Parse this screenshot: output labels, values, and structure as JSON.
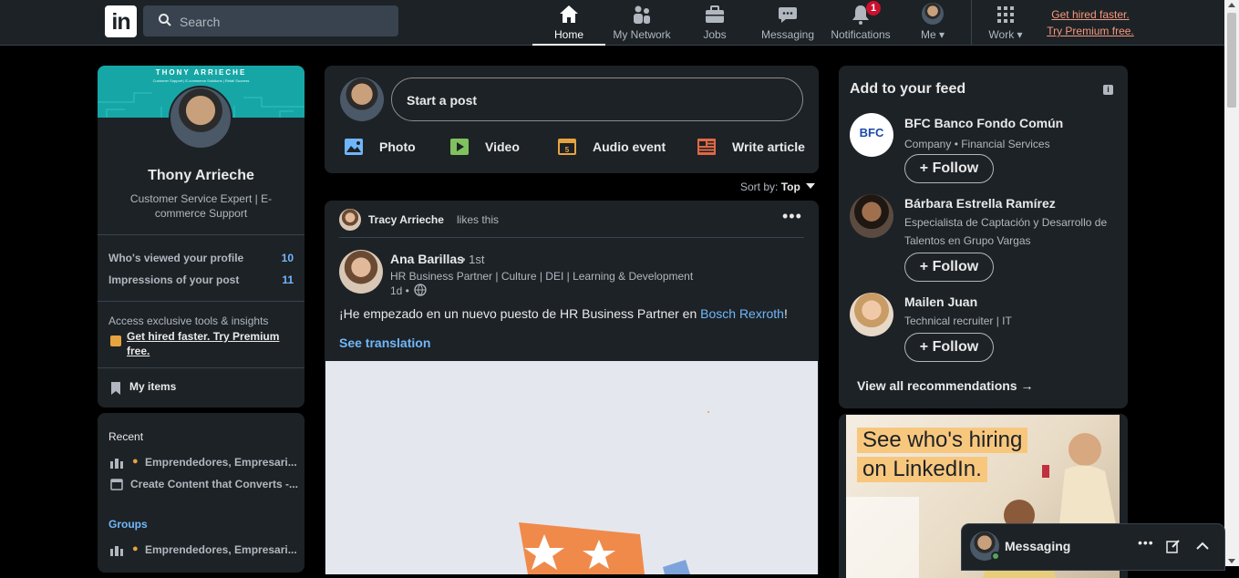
{
  "topbar": {
    "logo_text": "in",
    "search_placeholder": "Search",
    "nav": [
      {
        "label": "Home",
        "icon": "home-icon"
      },
      {
        "label": "My Network",
        "icon": "network-icon"
      },
      {
        "label": "Jobs",
        "icon": "briefcase-icon"
      },
      {
        "label": "Messaging",
        "icon": "chat-icon"
      },
      {
        "label": "Notifications",
        "icon": "bell-icon",
        "badge": "1"
      },
      {
        "label": "Me",
        "icon": "avatar"
      },
      {
        "label": "Work",
        "icon": "grid-icon"
      }
    ],
    "premium_line1": "Get hired faster.",
    "premium_line2": "Try Premium free."
  },
  "left": {
    "banner_title": "THONY ARRIECHE",
    "banner_sub": "Customer Support | E-commerce Solutions | Retail Success",
    "name": "Thony Arrieche",
    "headline": "Customer Service Expert | E-commerce Support",
    "stats": [
      {
        "label": "Who's viewed your profile",
        "value": "10"
      },
      {
        "label": "Impressions of your post",
        "value": "11"
      }
    ],
    "premium_promo": "Access exclusive tools & insights",
    "premium_link": "Get hired faster. Try Premium free.",
    "my_items": "My items",
    "recent_title": "Recent",
    "recent": [
      "Emprendedores, Empresari...",
      "Create Content that Converts -..."
    ],
    "groups_title": "Groups",
    "groups": [
      "Emprendedores, Empresari..."
    ]
  },
  "composer": {
    "placeholder": "Start a post",
    "actions": [
      "Photo",
      "Video",
      "Audio event",
      "Write article"
    ],
    "sort_label": "Sort by:",
    "sort_value": "Top"
  },
  "post": {
    "liker": "Tracy Arrieche",
    "liker_action": "likes this",
    "author": "Ana Barillas",
    "degree": "• 1st",
    "headline": "HR Business Partner | Culture | DEI | Learning & Development",
    "time": "1d •",
    "text_before": "¡He empezado en un nuevo puesto de HR Business Partner en ",
    "text_link": "Bosch Rexroth",
    "text_after": "!",
    "see_translation": "See translation"
  },
  "feed": {
    "title": "Add to your feed",
    "items": [
      {
        "name": "BFC Banco Fondo Común",
        "desc": "Company • Financial Services",
        "follow": "Follow",
        "logo_text": "BFC"
      },
      {
        "name": "Bárbara Estrella Ramírez",
        "desc": "Especialista de Captación y Desarrollo de Talentos en Grupo Vargas",
        "follow": "Follow"
      },
      {
        "name": "Mailen Juan",
        "desc": "Technical recruiter | IT",
        "follow": "Follow"
      }
    ],
    "view_all": "View all recommendations →"
  },
  "ad": {
    "line1": "See who's hiring",
    "line2": "on LinkedIn."
  },
  "messaging": {
    "label": "Messaging"
  }
}
